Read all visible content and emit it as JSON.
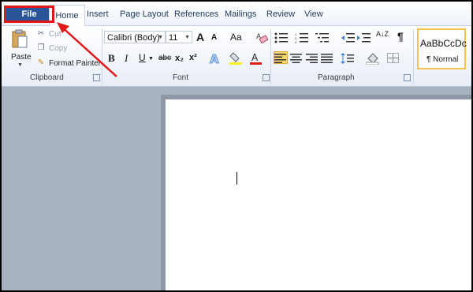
{
  "tabs": {
    "file": "File",
    "home": "Home",
    "insert": "Insert",
    "page_layout": "Page Layout",
    "references": "References",
    "mailings": "Mailings",
    "review": "Review",
    "view": "View"
  },
  "clipboard": {
    "paste": "Paste",
    "cut": "Cut",
    "copy": "Copy",
    "format_painter": "Format Painter",
    "group_label": "Clipboard"
  },
  "font": {
    "name": "Calibri (Body)",
    "size": "11",
    "grow": "A",
    "shrink": "A",
    "change_case": "Aa",
    "bold": "B",
    "italic": "I",
    "underline": "U",
    "strikethrough": "abc",
    "subscript": "x₂",
    "superscript": "x²",
    "group_label": "Font"
  },
  "paragraph": {
    "show_marks": "¶",
    "sort": "A↓Z",
    "group_label": "Paragraph"
  },
  "styles": {
    "sample": "AaBbCcDc",
    "name": "¶ Normal"
  },
  "colors": {
    "file_tab": "#2a5699",
    "highlight": "#e01818",
    "workspace": "#a9b3bf"
  }
}
